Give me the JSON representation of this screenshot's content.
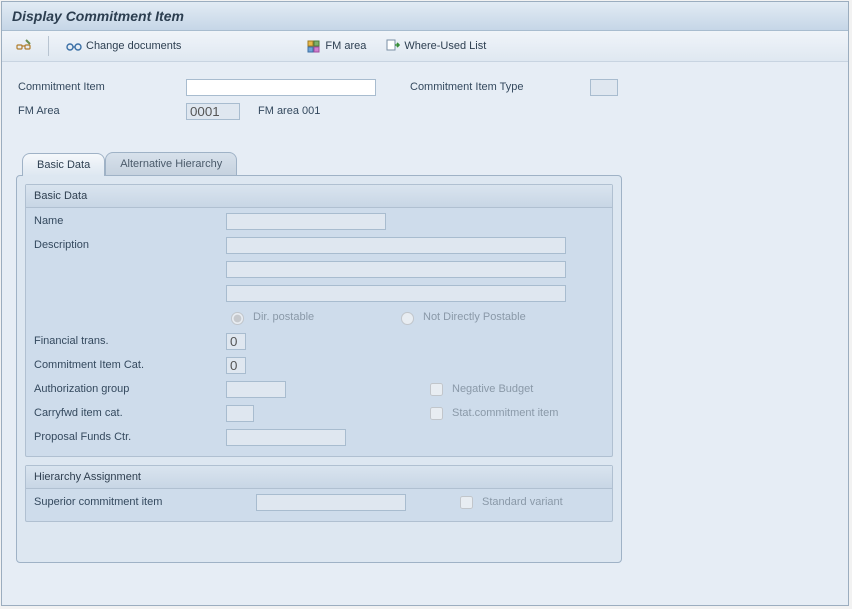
{
  "title": "Display Commitment Item",
  "toolbar": {
    "change_docs": "Change documents",
    "fm_area": "FM area",
    "where_used": "Where-Used List"
  },
  "header": {
    "commitment_item_label": "Commitment Item",
    "commitment_item_value": "",
    "commitment_item_type_label": "Commitment Item Type",
    "commitment_item_type_value": "",
    "fm_area_label": "FM Area",
    "fm_area_value": "0001",
    "fm_area_text": "FM area 001"
  },
  "tabs": {
    "basic": "Basic Data",
    "alt": "Alternative Hierarchy"
  },
  "basic_group": {
    "title": "Basic Data",
    "name_label": "Name",
    "name_value": "",
    "desc_label": "Description",
    "desc1": "",
    "desc2": "",
    "desc3": "",
    "dir_postable": "Dir. postable",
    "not_dir_postable": "Not Directly Postable",
    "fin_trans_label": "Financial trans.",
    "fin_trans_value": "0",
    "ci_cat_label": "Commitment Item Cat.",
    "ci_cat_value": "0",
    "auth_grp_label": "Authorization group",
    "auth_grp_value": "",
    "neg_budget": "Negative Budget",
    "carry_label": "Carryfwd item cat.",
    "carry_value": "",
    "stat_ci": "Stat.commitment item",
    "prop_label": "Proposal Funds Ctr.",
    "prop_value": ""
  },
  "hier_group": {
    "title": "Hierarchy Assignment",
    "sup_label": "Superior commitment item",
    "sup_value": "",
    "std_variant": "Standard variant"
  }
}
